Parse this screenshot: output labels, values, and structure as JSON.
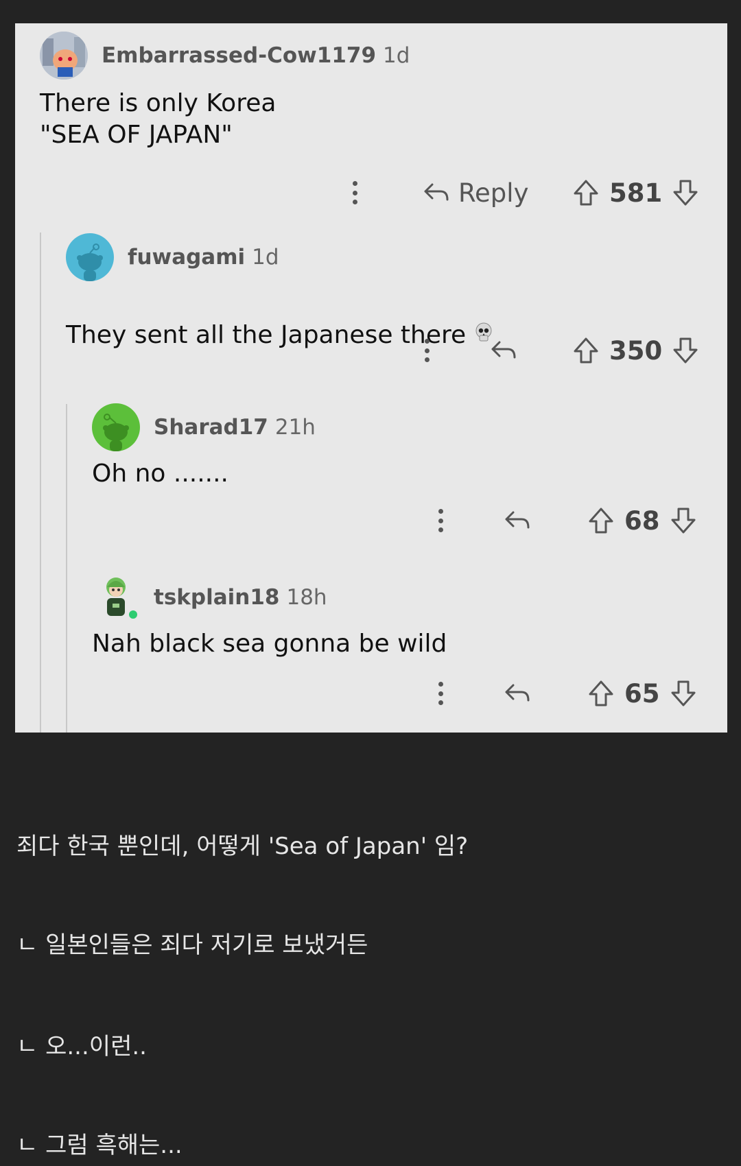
{
  "comments": [
    {
      "username": "Embarrassed-Cow1179",
      "age": "1d",
      "body": "There is only Korea\n\"SEA OF JAPAN\"",
      "reply_label": "Reply",
      "score": "581",
      "avatar_icon": "user-avatar-photo"
    },
    {
      "username": "fuwagami",
      "age": "1d",
      "body": "They sent all the Japanese there",
      "emoji": "skull-emoji",
      "score": "350",
      "avatar_icon": "snoo-avatar-blue"
    },
    {
      "username": "Sharad17",
      "age": "21h",
      "body": "Oh no .......",
      "score": "68",
      "avatar_icon": "snoo-avatar-green"
    },
    {
      "username": "tskplain18",
      "age": "18h",
      "body": "Nah black sea gonna be wild",
      "score": "65",
      "avatar_icon": "anime-avatar-green",
      "online": true
    }
  ],
  "translation": [
    "죄다 한국 뿐인데, 어떻게 'Sea of Japan' 임?",
    "ㄴ 일본인들은 죄다 저기로 보냈거든",
    "ㄴ 오...이런..",
    "ㄴ 그럼 흑해는..."
  ],
  "colors": {
    "page_bg": "#232323",
    "card_bg": "#e8e8e8",
    "blue_avatar": "#4fb8d6",
    "green_avatar": "#5cbf3a"
  }
}
